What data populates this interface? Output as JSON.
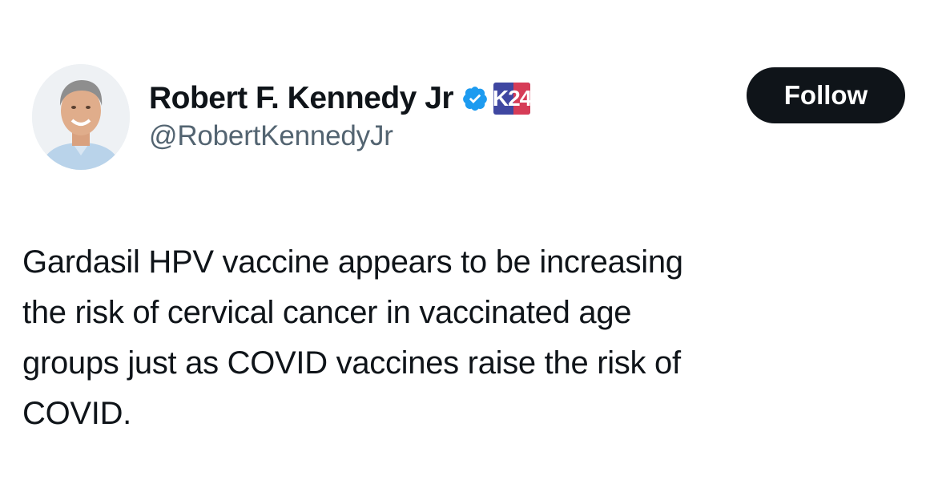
{
  "author": {
    "display_name": "Robert F. Kennedy Jr",
    "handle": "@RobertKennedyJr",
    "verified_icon": "verified-checkmark-icon",
    "affiliate_badge": "K24",
    "avatar_icon": "profile-photo"
  },
  "follow_button": {
    "label": "Follow"
  },
  "tweet": {
    "lines": [
      "Gardasil HPV vaccine appears to be increasing",
      "the risk of cervical cancer in vaccinated age",
      "groups just as COVID vaccines raise the risk of",
      "COVID."
    ]
  },
  "colors": {
    "text_primary": "#0f1419",
    "text_secondary": "#536471",
    "verified_blue": "#1d9bf0",
    "button_bg": "#0f1419",
    "badge_blue": "#3f47a1",
    "badge_red": "#d63c57"
  }
}
